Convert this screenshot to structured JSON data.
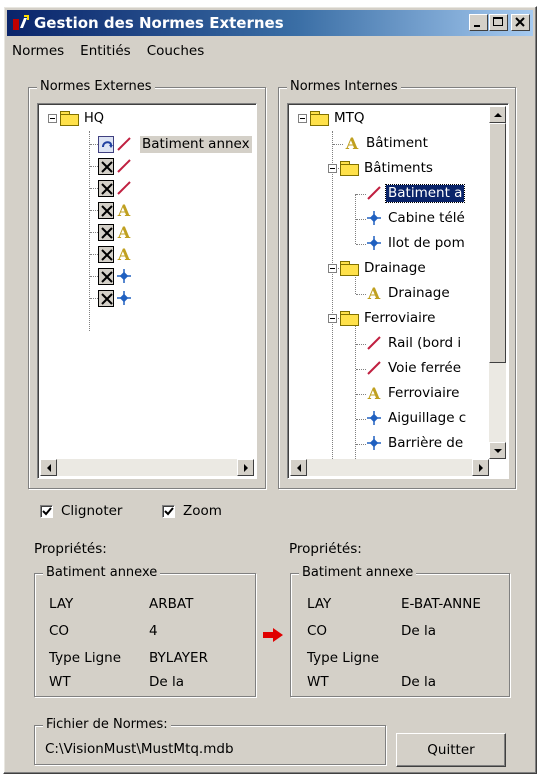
{
  "window": {
    "title": "Gestion des Normes Externes"
  },
  "menu": [
    "Normes",
    "Entitiés",
    "Couches"
  ],
  "external": {
    "legend": "Normes Externes",
    "root": "HQ",
    "first_item": "Batiment annex"
  },
  "internal": {
    "legend": "Normes Internes",
    "root": "MTQ",
    "items": {
      "batiment": "Bâtiment",
      "batiments": "Bâtiments",
      "batiment_a": "Batiment a",
      "cabine": "Cabine télé",
      "ilot": "Ilot de pom",
      "drainage_folder": "Drainage",
      "drainage": "Drainage",
      "ferroviaire_folder": "Ferroviaire",
      "rail": "Rail (bord i",
      "voie": "Voie ferrée",
      "ferroviaire": "Ferroviaire",
      "aiguillage": "Aiguillage c",
      "barriere": "Barrière de"
    }
  },
  "options": {
    "blink_label": "Clignoter",
    "blink_checked": true,
    "zoom_label": "Zoom",
    "zoom_checked": true
  },
  "props_left": {
    "caption": "Propriétés:",
    "legend": "Batiment annexe",
    "rows": [
      {
        "k": "LAY",
        "v": "ARBAT"
      },
      {
        "k": "CO",
        "v": "4"
      },
      {
        "k": "Type Ligne",
        "v": "BYLAYER"
      },
      {
        "k": "WT",
        "v": "De la"
      }
    ]
  },
  "props_right": {
    "caption": "Propriétés:",
    "legend": "Batiment annexe",
    "rows": [
      {
        "k": "LAY",
        "v": "E-BAT-ANNE"
      },
      {
        "k": "CO",
        "v": "De la"
      },
      {
        "k": "Type Ligne",
        "v": ""
      },
      {
        "k": "WT",
        "v": "De la"
      }
    ]
  },
  "file": {
    "legend": "Fichier de Normes:",
    "path": "C:\\VisionMust\\MustMtq.mdb"
  },
  "quit_label": "Quitter",
  "colors": {
    "title_start": "#0a246a",
    "title_end": "#a6caf0",
    "face": "#d4d0c8",
    "selection": "#0a246a",
    "arrow": "#e00000"
  }
}
